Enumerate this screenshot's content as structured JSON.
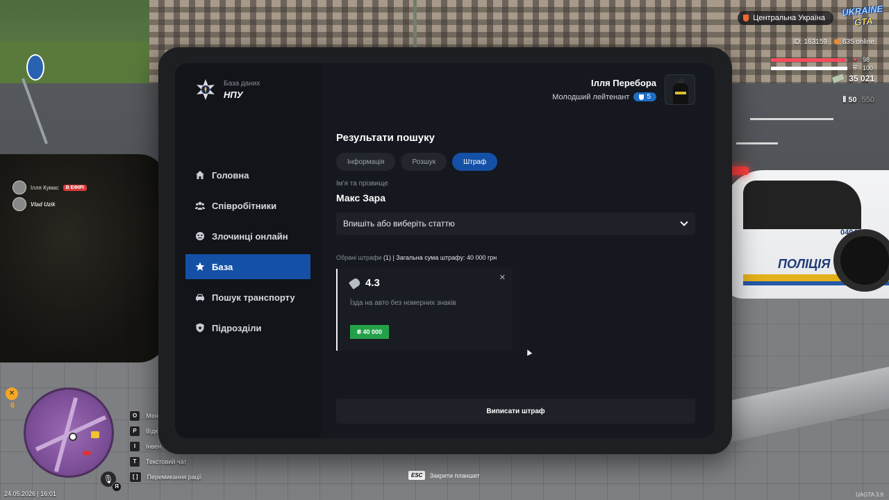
{
  "hud": {
    "region": "Центральна Україна",
    "logo_line1": "UKRAINE",
    "logo_line2": "GTA",
    "player_id": "ID: 163159",
    "online": "635 online",
    "health": "98",
    "health_fraction": 0.98,
    "armor": "100",
    "armor_fraction": 1.0,
    "money": "35 021",
    "ammo_clip": "50",
    "ammo_total": "550",
    "wanted_level": "6",
    "datetime": "24.05.2026 | 16:01",
    "mic_key": "Я",
    "version": "UAGTA 3.9",
    "colors": {
      "health": "#ff4b5c",
      "armor": "#ffffff",
      "accent": "#1451a6",
      "money_badge": "#24a148"
    }
  },
  "chat_overlay": [
    {
      "name": "Ілля Кумас",
      "badge": "В ЕФІРІ"
    },
    {
      "name": "Vlad Uzik",
      "badge": ""
    }
  ],
  "hints": [
    {
      "key": "O",
      "label": "Мен"
    },
    {
      "key": "P",
      "label": "Відк"
    },
    {
      "key": "I",
      "label": "Інвен"
    },
    {
      "key": "T",
      "label": "Текстовий чат"
    },
    {
      "key": "[ ]",
      "label": "Перемикання рації"
    }
  ],
  "esc_hint": {
    "key": "ESC",
    "label": "Закрити планшет"
  },
  "background": {
    "police_car_text": "ПОЛІЦІЯ",
    "police_car_number": "0404"
  },
  "tablet": {
    "brand": {
      "subtitle": "База даних",
      "name": "НПУ"
    },
    "user": {
      "name": "Ілля Перебора",
      "rank": "Молодший лейтенант",
      "rank_level": "5"
    },
    "nav": [
      {
        "label": "Головна",
        "icon": "home-icon",
        "active": false
      },
      {
        "label": "Співробітники",
        "icon": "users-icon",
        "active": false
      },
      {
        "label": "Злочинці онлайн",
        "icon": "criminal-icon",
        "active": false
      },
      {
        "label": "База",
        "icon": "star-icon",
        "active": true
      },
      {
        "label": "Пошук транспорту",
        "icon": "car-icon",
        "active": false
      },
      {
        "label": "Підрозділи",
        "icon": "shield-icon",
        "active": false
      }
    ],
    "main": {
      "title": "Результати пошуку",
      "tabs": [
        {
          "label": "Інформація",
          "active": false
        },
        {
          "label": "Розшук",
          "active": false
        },
        {
          "label": "Штраф",
          "active": true
        }
      ],
      "name_label": "Ім'я та прізвище",
      "name_value": "Макс Зара",
      "article_select_placeholder": "Впишіть або виберіть статтю",
      "summary_label": "Обрані штрафи",
      "summary_count": "(1)",
      "summary_total": "| Загальна сума штрафу: 40 000 грн",
      "fines": [
        {
          "article": "4.3",
          "description": "Їзда на авто без номерних знаків",
          "amount": "₴ 40 000"
        }
      ],
      "submit_label": "Виписати штраф"
    }
  }
}
